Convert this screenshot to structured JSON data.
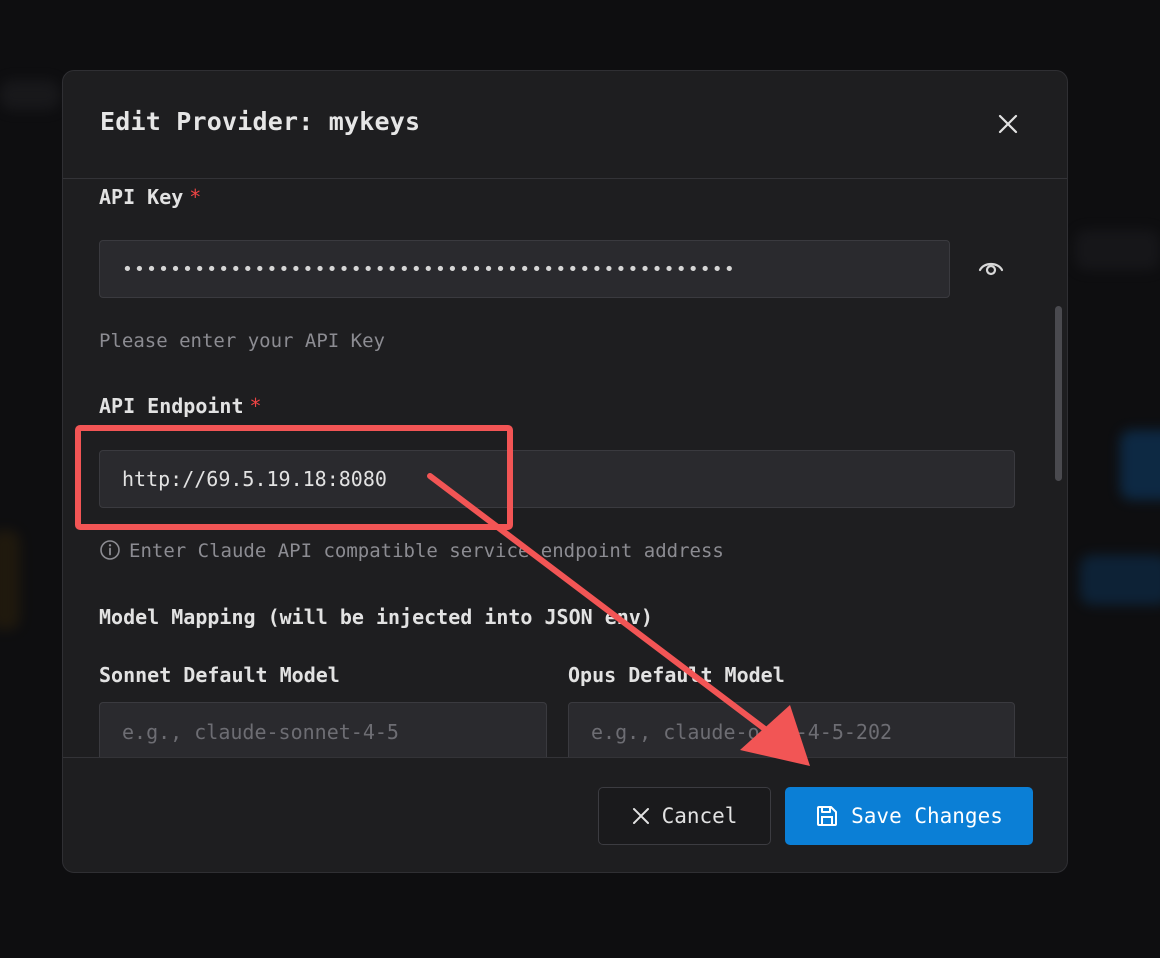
{
  "modal": {
    "title": "Edit Provider: mykeys"
  },
  "form": {
    "api_key": {
      "label": "API Key",
      "required_mark": "*",
      "masked_value": "•••••••••••••••••••••••••••••••••••••••••••••••••••",
      "help": "Please enter your API Key"
    },
    "api_endpoint": {
      "label": "API Endpoint",
      "required_mark": "*",
      "value": "http://69.5.19.18:8080",
      "help": "Enter Claude API compatible service endpoint address"
    },
    "model_mapping": {
      "heading": "Model Mapping (will be injected into JSON env)",
      "sonnet": {
        "label": "Sonnet Default Model",
        "placeholder": "e.g., claude-sonnet-4-5"
      },
      "opus": {
        "label": "Opus Default Model",
        "placeholder": "e.g., claude-opus-4-5-202"
      }
    }
  },
  "footer": {
    "cancel_label": "Cancel",
    "save_label": "Save Changes"
  },
  "colors": {
    "accent": "#0b7fd6",
    "required": "#ef4444",
    "annotation": "#f25555"
  },
  "icons": {
    "close": "close-icon",
    "eye": "eye-icon",
    "info": "info-icon",
    "cancel": "x-icon",
    "save": "save-icon"
  }
}
